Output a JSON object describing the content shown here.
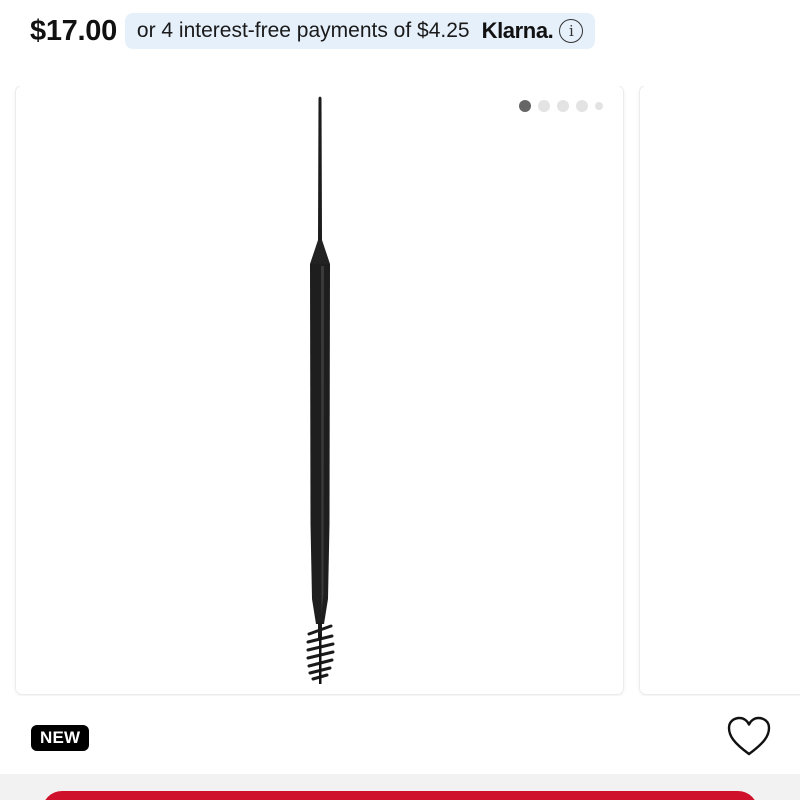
{
  "price": {
    "amount": "$17.00"
  },
  "klarna": {
    "text": "or 4 interest-free payments of $4.25",
    "logo": "Klarna.",
    "info_icon": "i"
  },
  "carousel": {
    "total_images": 5,
    "active_index": 0
  },
  "product": {
    "badge": "NEW",
    "image_icon": "spoolie-brow-brush"
  },
  "colors": {
    "klarna_pill_bg": "#e6f0fb",
    "badge_bg": "#000000",
    "cta_bg": "#cf112c",
    "dot_active": "#666666",
    "dot_inactive": "#e3e3e3"
  }
}
